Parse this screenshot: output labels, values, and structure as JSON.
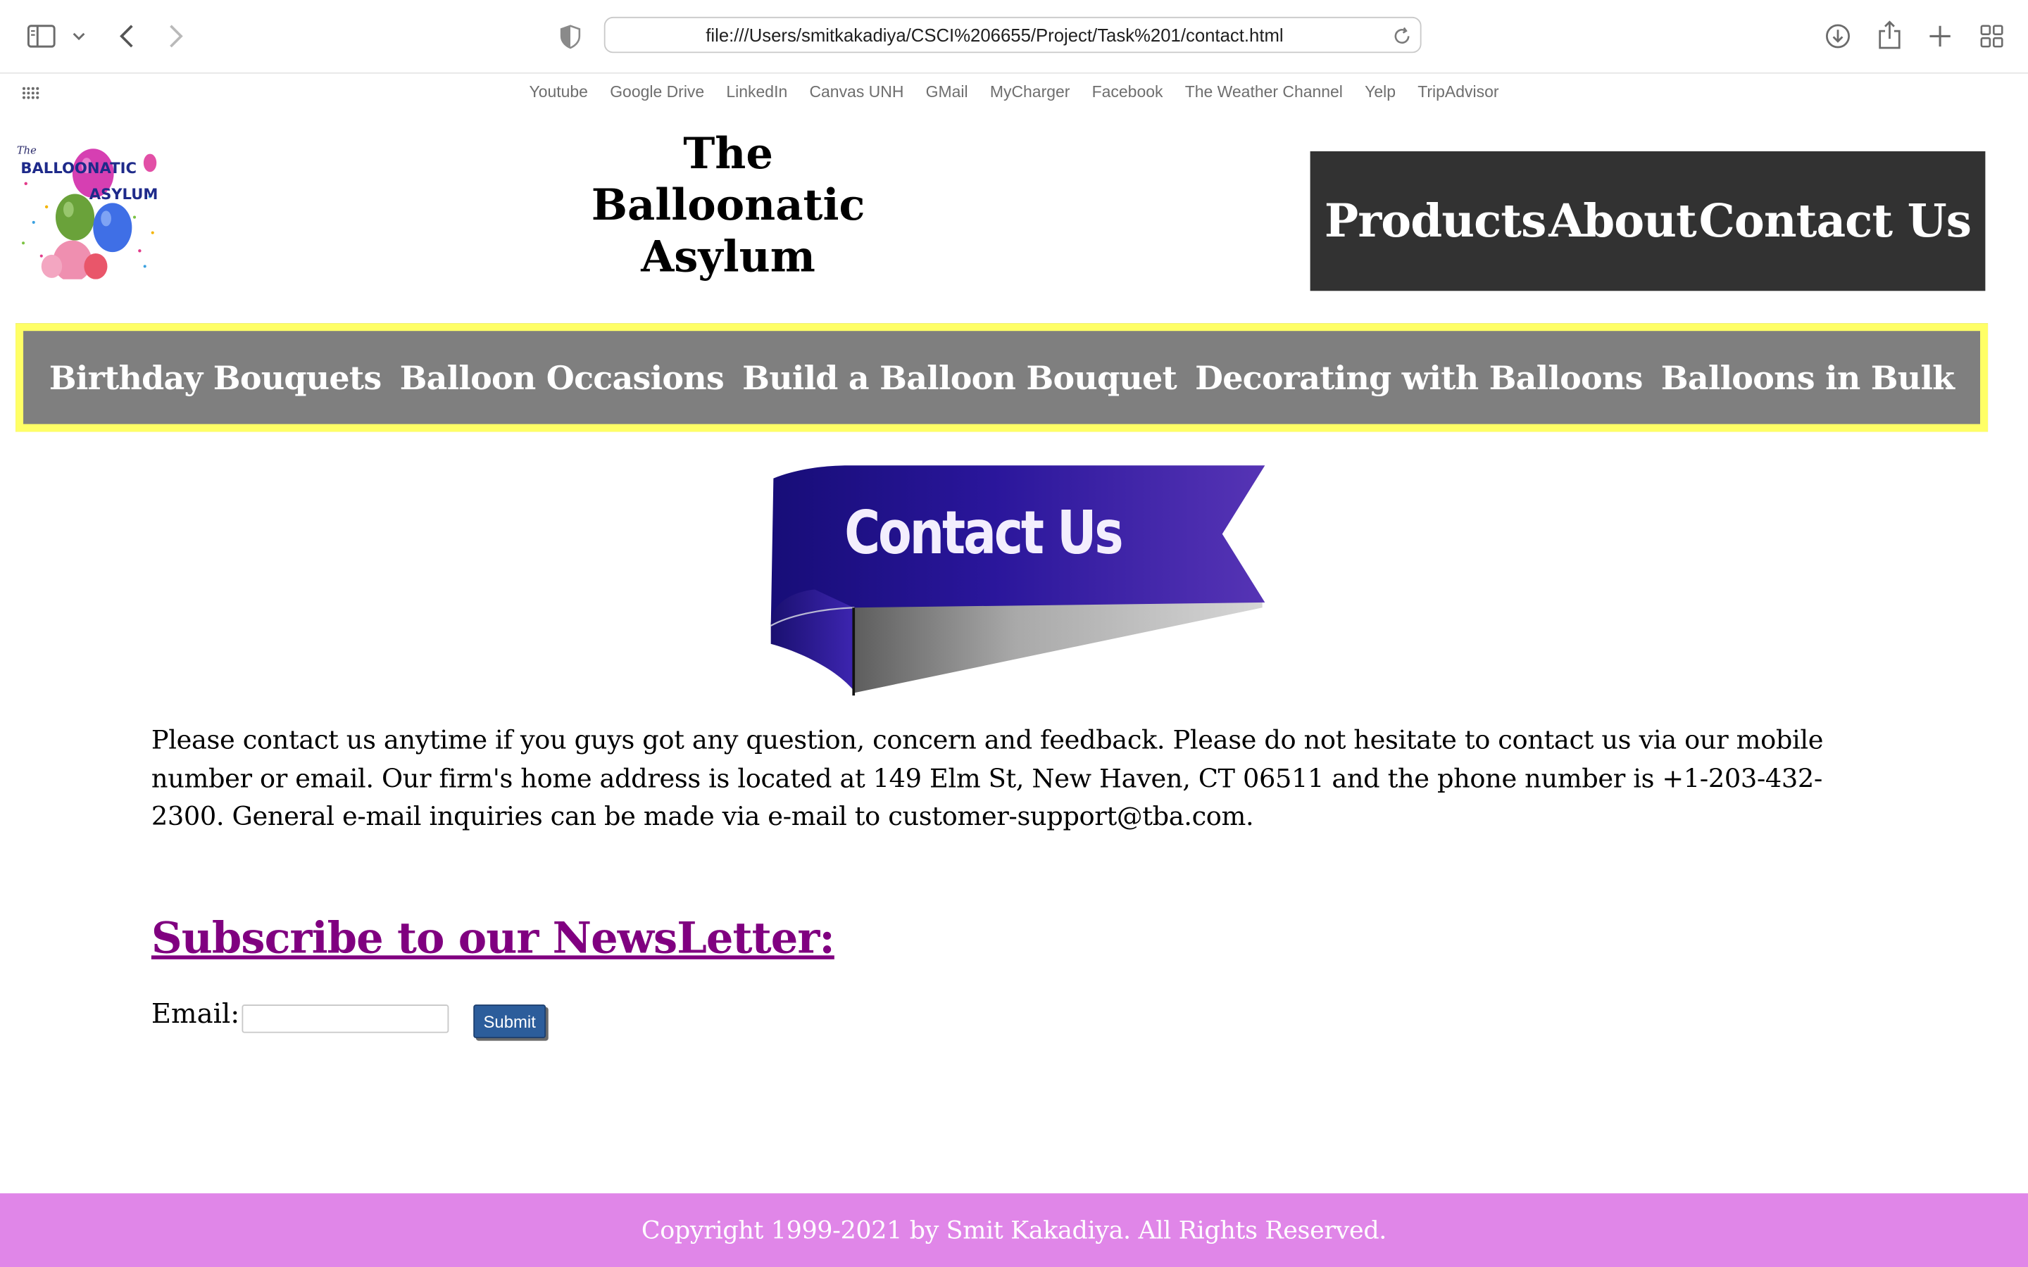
{
  "browser": {
    "url": "file:///Users/smitkakadiya/CSCI%206655/Project/Task%201/contact.html",
    "bookmarks": [
      "Youtube",
      "Google Drive",
      "LinkedIn",
      "Canvas UNH",
      "GMail",
      "MyCharger",
      "Facebook",
      "The Weather Channel",
      "Yelp",
      "TripAdvisor"
    ],
    "icons": [
      "sidebar-icon",
      "chevron-down-icon",
      "back-icon",
      "forward-icon",
      "shield-icon",
      "reload-icon",
      "download-icon",
      "share-icon",
      "new-tab-icon",
      "tab-overview-icon",
      "apps-grid-icon"
    ]
  },
  "header": {
    "logo": {
      "line1": "The",
      "line2": "BALLOONATIC",
      "line3": "ASYLUM"
    },
    "title_lines": [
      "The",
      "Balloonatic",
      "Asylum"
    ],
    "main_nav": [
      "Products",
      "About",
      "Contact Us"
    ]
  },
  "sub_nav": [
    "Birthday Bouquets",
    "Balloon Occasions",
    "Build a Balloon Bouquet",
    "Decorating with Balloons",
    "Balloons in Bulk"
  ],
  "banner": {
    "text": "Contact Us"
  },
  "content": {
    "intro": "Please contact us anytime if you guys got any question, concern and feedback. Please do not hesitate to contact us via our mobile number or email. Our firm's home address is located at 149 Elm St, New Haven, CT 06511 and the phone number is +1-203-432-2300. General e-mail inquiries can be made via e-mail to customer-support@tba.com.",
    "subscribe_heading": "Subscribe to our NewsLetter:",
    "email_label": "Email:",
    "email_value": "",
    "submit_label": "Submit"
  },
  "footer": {
    "copyright": "Copyright 1999-2021 by Smit Kakadiya. All Rights Reserved."
  },
  "colors": {
    "main_nav_bg": "#323232",
    "sub_nav_bg": "#7f7f7f",
    "sub_nav_border": "#ffff66",
    "subscribe_heading": "#800080",
    "submit_bg": "#2c5d9b",
    "footer_bg": "#e086e8",
    "banner_ribbon": "#3a1f9a"
  }
}
